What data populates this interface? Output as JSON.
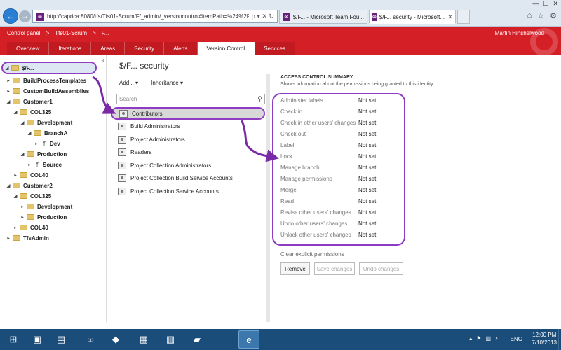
{
  "browser": {
    "address": "http://caprica:8080/tfs/Tfs01-Scrum/F/_admin/_versioncontrol#itemPath=%24%2FFiser",
    "address_icons": "ρ ▾ ✕ ↻",
    "tabs": [
      {
        "label": "$/F... - Microsoft Team Fou..."
      },
      {
        "label": "$/F... security - Microsoft..."
      }
    ],
    "window_controls": [
      "—",
      "☐",
      "✕"
    ],
    "chrome_icons": [
      "⌂",
      "☆",
      "⚙"
    ]
  },
  "header": {
    "breadcrumb": [
      "Control panel",
      ">",
      "Tfs01-Scrum",
      ">",
      "F..."
    ],
    "user": "Martin Hinshelwood",
    "tabs": [
      "Overview",
      "Iterations",
      "Areas",
      "Security",
      "Alerts",
      "Version Control",
      "Services"
    ],
    "active_tab": "Version Control"
  },
  "tree": {
    "items": [
      {
        "label": "$/F...",
        "kind": "root"
      },
      {
        "label": "BuildProcessTemplates",
        "kind": "folder"
      },
      {
        "label": "CustomBuildAssemblies",
        "kind": "folder"
      },
      {
        "label": "Customer1",
        "kind": "folder"
      },
      {
        "label": "COL325",
        "kind": "folder"
      },
      {
        "label": "Development",
        "kind": "folder"
      },
      {
        "label": "BranchA",
        "kind": "folder"
      },
      {
        "label": "Dev",
        "kind": "branch"
      },
      {
        "label": "Production",
        "kind": "folder"
      },
      {
        "label": "Source",
        "kind": "branch"
      },
      {
        "label": "COL40",
        "kind": "folder"
      },
      {
        "label": "Customer2",
        "kind": "folder"
      },
      {
        "label": "COL325",
        "kind": "folder"
      },
      {
        "label": "Development",
        "kind": "folder"
      },
      {
        "label": "Production",
        "kind": "folder"
      },
      {
        "label": "COL40",
        "kind": "folder"
      },
      {
        "label": "TfsAdmin",
        "kind": "folder"
      }
    ]
  },
  "security": {
    "title": "$/F... security",
    "add_label": "Add...",
    "inheritance_label": "Inheritance",
    "search_placeholder": "Search",
    "groups": [
      "Contributors",
      "Build Administrators",
      "Project Administrators",
      "Readers",
      "Project Collection Administrators",
      "Project Collection Build Service Accounts",
      "Project Collection Service Accounts"
    ],
    "selected_group": "Contributors"
  },
  "acs": {
    "title": "ACCESS CONTROL SUMMARY",
    "subtitle": "Shows information about the permissions being granted to this identity",
    "permissions": [
      {
        "name": "Administer labels",
        "value": "Not set"
      },
      {
        "name": "Check in",
        "value": "Not set"
      },
      {
        "name": "Check in other users' changes",
        "value": "Not set"
      },
      {
        "name": "Check out",
        "value": "Not set"
      },
      {
        "name": "Label",
        "value": "Not set"
      },
      {
        "name": "Lock",
        "value": "Not set"
      },
      {
        "name": "Manage branch",
        "value": "Not set"
      },
      {
        "name": "Manage permissions",
        "value": "Not set"
      },
      {
        "name": "Merge",
        "value": "Not set"
      },
      {
        "name": "Read",
        "value": "Not set"
      },
      {
        "name": "Revise other users' changes",
        "value": "Not set"
      },
      {
        "name": "Undo other users' changes",
        "value": "Not set"
      },
      {
        "name": "Unlock other users' changes",
        "value": "Not set"
      }
    ],
    "clear_link": "Clear explicit permissions",
    "remove_label": "Remove",
    "save_label": "Save changes",
    "undo_label": "Undo changes"
  },
  "taskbar": {
    "apps": [
      "⊞",
      "▣",
      "▤",
      "∞",
      "◆",
      "▦",
      "▥",
      "▰",
      "e"
    ],
    "lang": "ENG",
    "time": "12:00 PM",
    "date": "7/10/2013",
    "tray_icons": [
      "▴",
      "⚑",
      "▥",
      "♪"
    ]
  },
  "colors": {
    "tfs_red": "#d51f26",
    "annotation_purple": "#8e3cc2",
    "taskbar_blue": "#1b4d7a"
  }
}
